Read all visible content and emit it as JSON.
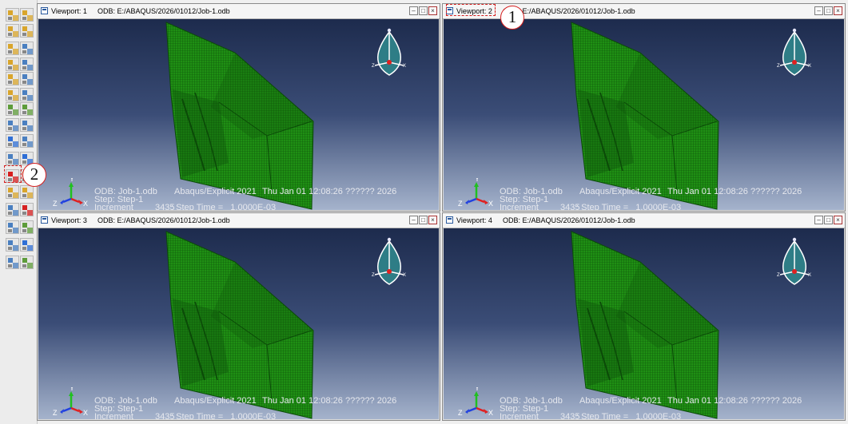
{
  "toolbox": {
    "tools": [
      {
        "name": "viewport-grid-tool",
        "color": "#d9a52b"
      },
      {
        "name": "viewport-grid-alt-tool",
        "color": "#d9a52b"
      },
      {
        "name": "viewport-layout-tool",
        "color": "#d9a52b"
      },
      {
        "name": "viewport-layout-alt-tool",
        "color": "#d9a52b"
      },
      {
        "name": "tile-horizontal-tool",
        "color": "#d9a52b"
      },
      {
        "name": "tile-vertical-tool",
        "color": "#4a7fc0"
      },
      {
        "name": "cascade-tool",
        "color": "#d9a52b"
      },
      {
        "name": "cascade-alt-tool",
        "color": "#4a7fc0"
      },
      {
        "name": "link-viewports-tool",
        "color": "#d9a52b"
      },
      {
        "name": "link-viewports-alt-tool",
        "color": "#4a7fc0"
      },
      {
        "name": "plot-contours-tool",
        "color": "#d9a52b"
      },
      {
        "name": "plot-contours-alt-tool",
        "color": "#4a7fc0"
      },
      {
        "name": "chart-tool",
        "color": "#5d9c3a"
      },
      {
        "name": "chart-alt-tool",
        "color": "#5d9c3a"
      },
      {
        "name": "list-tool",
        "color": "#4a7fc0"
      },
      {
        "name": "list-alt-tool",
        "color": "#4a7fc0"
      },
      {
        "name": "triad-tool",
        "color": "#2f6fd6"
      },
      {
        "name": "table-tool",
        "color": "#4a7fc0"
      },
      {
        "name": "viewport-annotation-tool",
        "color": "#4a7fc0"
      },
      {
        "name": "arrow-tool",
        "color": "#2f6fd6"
      },
      {
        "name": "xy-plot-tool",
        "color": "#d62020"
      },
      {
        "name": "sweep-tool",
        "color": "#d9a52b"
      },
      {
        "name": "sweep-alt-tool",
        "color": "#d9a52b"
      },
      {
        "name": "overlay-tool",
        "color": "#d9a52b"
      },
      {
        "name": "overlay-alt-tool",
        "color": "#4a7fc0"
      },
      {
        "name": "color-code-tool",
        "color": "#d62020"
      },
      {
        "name": "color-code-alt-tool",
        "color": "#4a7fc0"
      },
      {
        "name": "common-options-tool",
        "color": "#5d9c3a"
      },
      {
        "name": "common-options-alt-tool",
        "color": "#4a7fc0"
      },
      {
        "name": "superimpose-tool",
        "color": "#2f6fd6"
      },
      {
        "name": "superimpose-alt-tool",
        "color": "#4a7fc0"
      },
      {
        "name": "pick-tool",
        "color": "#5d9c3a"
      }
    ]
  },
  "viewports": [
    {
      "name": "Viewport: 1",
      "path": "ODB: E:/ABAQUS/2026/01012/Job-1.odb"
    },
    {
      "name": "Viewport: 2",
      "path": "ODB: E:/ABAQUS/2026/01012/Job-1.odb"
    },
    {
      "name": "Viewport: 3",
      "path": "ODB: E:/ABAQUS/2026/01012/Job-1.odb"
    },
    {
      "name": "Viewport: 4",
      "path": "ODB: E:/ABAQUS/2026/01012/Job-1.odb"
    }
  ],
  "info": {
    "odb": "ODB: Job-1.odb",
    "solver": "Abaqus/Explicit 2021",
    "date": "Thu Jan 01 12:08:26 ?????? 2026",
    "step": "Step: Step-1",
    "increment_label": "Increment",
    "increment_value": "3435",
    "step_time": ": Step Time =   1.0000E-03"
  },
  "triad_labels": {
    "x": "X",
    "y": "Y",
    "z": "Z"
  },
  "window_buttons": {
    "minimize": "–",
    "restore": "□",
    "close": "×"
  },
  "callouts": {
    "one": "1",
    "two": "2"
  },
  "colors": {
    "mesh": "#1f8f14",
    "mesh_dark": "#0b4a08",
    "viewport_bg_top": "#1d2b4d",
    "viewport_bg_bottom": "#a5b3cc",
    "highlight": "#d62020",
    "triad_fill": "#2e7d86"
  }
}
